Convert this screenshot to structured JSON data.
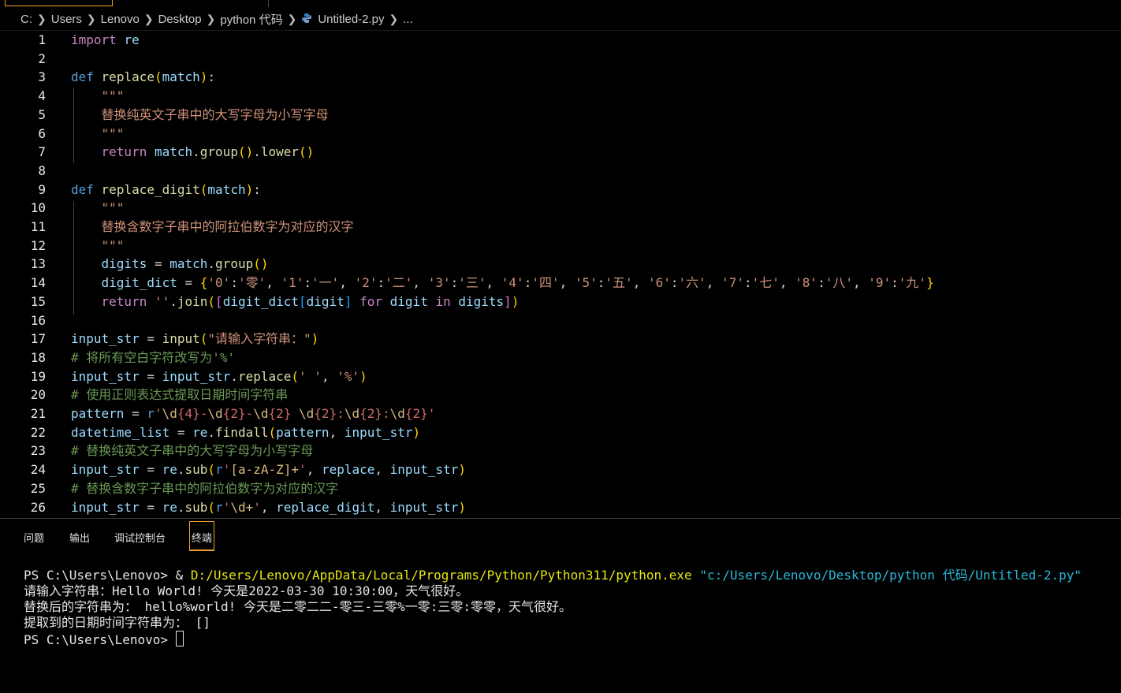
{
  "breadcrumb": {
    "items": [
      "C:",
      "Users",
      "Lenovo",
      "Desktop",
      "python 代码",
      "Untitled-2.py",
      "..."
    ],
    "separator": ">"
  },
  "editor": {
    "lines": [
      {
        "n": "1",
        "tokens": [
          [
            "kwc",
            "import"
          ],
          [
            "op",
            " "
          ],
          [
            "var",
            "re"
          ]
        ]
      },
      {
        "n": "2",
        "tokens": []
      },
      {
        "n": "3",
        "tokens": [
          [
            "kw",
            "def"
          ],
          [
            "op",
            " "
          ],
          [
            "fn",
            "replace"
          ],
          [
            "b1",
            "("
          ],
          [
            "var",
            "match"
          ],
          [
            "b1",
            ")"
          ],
          [
            "op",
            ":"
          ]
        ]
      },
      {
        "n": "4",
        "tokens": [
          [
            "op",
            "    "
          ],
          [
            "str",
            "\"\"\""
          ]
        ]
      },
      {
        "n": "5",
        "tokens": [
          [
            "op",
            "    "
          ],
          [
            "str",
            "替换纯英文子串中的大写字母为小写字母"
          ]
        ]
      },
      {
        "n": "6",
        "tokens": [
          [
            "op",
            "    "
          ],
          [
            "str",
            "\"\"\""
          ]
        ]
      },
      {
        "n": "7",
        "tokens": [
          [
            "op",
            "    "
          ],
          [
            "kwc",
            "return"
          ],
          [
            "op",
            " "
          ],
          [
            "var",
            "match"
          ],
          [
            "op",
            "."
          ],
          [
            "fn",
            "group"
          ],
          [
            "b1",
            "()"
          ],
          [
            "op",
            "."
          ],
          [
            "fn",
            "lower"
          ],
          [
            "b1",
            "()"
          ]
        ]
      },
      {
        "n": "8",
        "tokens": []
      },
      {
        "n": "9",
        "tokens": [
          [
            "kw",
            "def"
          ],
          [
            "op",
            " "
          ],
          [
            "fn",
            "replace_digit"
          ],
          [
            "b1",
            "("
          ],
          [
            "var",
            "match"
          ],
          [
            "b1",
            ")"
          ],
          [
            "op",
            ":"
          ]
        ]
      },
      {
        "n": "10",
        "tokens": [
          [
            "op",
            "    "
          ],
          [
            "str",
            "\"\"\""
          ]
        ]
      },
      {
        "n": "11",
        "tokens": [
          [
            "op",
            "    "
          ],
          [
            "str",
            "替换含数字子串中的阿拉伯数字为对应的汉字"
          ]
        ]
      },
      {
        "n": "12",
        "tokens": [
          [
            "op",
            "    "
          ],
          [
            "str",
            "\"\"\""
          ]
        ]
      },
      {
        "n": "13",
        "tokens": [
          [
            "op",
            "    "
          ],
          [
            "var",
            "digits"
          ],
          [
            "op",
            " = "
          ],
          [
            "var",
            "match"
          ],
          [
            "op",
            "."
          ],
          [
            "fn",
            "group"
          ],
          [
            "b1",
            "()"
          ]
        ]
      },
      {
        "n": "14",
        "tokens": [
          [
            "op",
            "    "
          ],
          [
            "var",
            "digit_dict"
          ],
          [
            "op",
            " = "
          ],
          [
            "b1",
            "{"
          ],
          [
            "str",
            "'0'"
          ],
          [
            "op",
            ":"
          ],
          [
            "str",
            "'零'"
          ],
          [
            "op",
            ", "
          ],
          [
            "str",
            "'1'"
          ],
          [
            "op",
            ":"
          ],
          [
            "str",
            "'一'"
          ],
          [
            "op",
            ", "
          ],
          [
            "str",
            "'2'"
          ],
          [
            "op",
            ":"
          ],
          [
            "str",
            "'二'"
          ],
          [
            "op",
            ", "
          ],
          [
            "str",
            "'3'"
          ],
          [
            "op",
            ":"
          ],
          [
            "str",
            "'三'"
          ],
          [
            "op",
            ", "
          ],
          [
            "str",
            "'4'"
          ],
          [
            "op",
            ":"
          ],
          [
            "str",
            "'四'"
          ],
          [
            "op",
            ", "
          ],
          [
            "str",
            "'5'"
          ],
          [
            "op",
            ":"
          ],
          [
            "str",
            "'五'"
          ],
          [
            "op",
            ", "
          ],
          [
            "str",
            "'6'"
          ],
          [
            "op",
            ":"
          ],
          [
            "str",
            "'六'"
          ],
          [
            "op",
            ", "
          ],
          [
            "str",
            "'7'"
          ],
          [
            "op",
            ":"
          ],
          [
            "str",
            "'七'"
          ],
          [
            "op",
            ", "
          ],
          [
            "str",
            "'8'"
          ],
          [
            "op",
            ":"
          ],
          [
            "str",
            "'八'"
          ],
          [
            "op",
            ", "
          ],
          [
            "str",
            "'9'"
          ],
          [
            "op",
            ":"
          ],
          [
            "str",
            "'九'"
          ],
          [
            "b1",
            "}"
          ]
        ]
      },
      {
        "n": "15",
        "tokens": [
          [
            "op",
            "    "
          ],
          [
            "kwc",
            "return"
          ],
          [
            "op",
            " "
          ],
          [
            "str",
            "''"
          ],
          [
            "op",
            "."
          ],
          [
            "fn",
            "join"
          ],
          [
            "b1",
            "("
          ],
          [
            "b2",
            "["
          ],
          [
            "var",
            "digit_dict"
          ],
          [
            "b3",
            "["
          ],
          [
            "var",
            "digit"
          ],
          [
            "b3",
            "]"
          ],
          [
            "op",
            " "
          ],
          [
            "kwc",
            "for"
          ],
          [
            "op",
            " "
          ],
          [
            "var",
            "digit"
          ],
          [
            "op",
            " "
          ],
          [
            "kwc",
            "in"
          ],
          [
            "op",
            " "
          ],
          [
            "var",
            "digits"
          ],
          [
            "b2",
            "]"
          ],
          [
            "b1",
            ")"
          ]
        ]
      },
      {
        "n": "16",
        "tokens": []
      },
      {
        "n": "17",
        "tokens": [
          [
            "var",
            "input_str"
          ],
          [
            "op",
            " = "
          ],
          [
            "fn",
            "input"
          ],
          [
            "b1",
            "("
          ],
          [
            "str",
            "\"请输入字符串：\""
          ],
          [
            "b1",
            ")"
          ]
        ]
      },
      {
        "n": "18",
        "tokens": [
          [
            "cm",
            "# 将所有空白字符改写为'%'"
          ]
        ]
      },
      {
        "n": "19",
        "tokens": [
          [
            "var",
            "input_str"
          ],
          [
            "op",
            " = "
          ],
          [
            "var",
            "input_str"
          ],
          [
            "op",
            "."
          ],
          [
            "fn",
            "replace"
          ],
          [
            "b1",
            "("
          ],
          [
            "str",
            "' '"
          ],
          [
            "op",
            ", "
          ],
          [
            "str",
            "'%'"
          ],
          [
            "b1",
            ")"
          ]
        ]
      },
      {
        "n": "20",
        "tokens": [
          [
            "cm",
            "# 使用正则表达式提取日期时间字符串"
          ]
        ]
      },
      {
        "n": "21",
        "tokens": [
          [
            "var",
            "pattern"
          ],
          [
            "op",
            " = "
          ],
          [
            "kw",
            "r"
          ],
          [
            "re",
            "'"
          ],
          [
            "rx",
            "\\d"
          ],
          [
            "re",
            "{4}-"
          ],
          [
            "rx",
            "\\d"
          ],
          [
            "re",
            "{2}-"
          ],
          [
            "rx",
            "\\d"
          ],
          [
            "re",
            "{2} "
          ],
          [
            "rx",
            "\\d"
          ],
          [
            "re",
            "{2}:"
          ],
          [
            "rx",
            "\\d"
          ],
          [
            "re",
            "{2}:"
          ],
          [
            "rx",
            "\\d"
          ],
          [
            "re",
            "{2}'"
          ]
        ]
      },
      {
        "n": "22",
        "tokens": [
          [
            "var",
            "datetime_list"
          ],
          [
            "op",
            " = "
          ],
          [
            "var",
            "re"
          ],
          [
            "op",
            "."
          ],
          [
            "fn",
            "findall"
          ],
          [
            "b1",
            "("
          ],
          [
            "var",
            "pattern"
          ],
          [
            "op",
            ", "
          ],
          [
            "var",
            "input_str"
          ],
          [
            "b1",
            ")"
          ]
        ]
      },
      {
        "n": "23",
        "tokens": [
          [
            "cm",
            "# 替换纯英文子串中的大写字母为小写字母"
          ]
        ]
      },
      {
        "n": "24",
        "tokens": [
          [
            "var",
            "input_str"
          ],
          [
            "op",
            " = "
          ],
          [
            "var",
            "re"
          ],
          [
            "op",
            "."
          ],
          [
            "fn",
            "sub"
          ],
          [
            "b1",
            "("
          ],
          [
            "kw",
            "r"
          ],
          [
            "re",
            "'"
          ],
          [
            "rx",
            "[a-zA-Z]+"
          ],
          [
            "re",
            "'"
          ],
          [
            "op",
            ", "
          ],
          [
            "var",
            "replace"
          ],
          [
            "op",
            ", "
          ],
          [
            "var",
            "input_str"
          ],
          [
            "b1",
            ")"
          ]
        ]
      },
      {
        "n": "25",
        "tokens": [
          [
            "cm",
            "# 替换含数字子串中的阿拉伯数字为对应的汉字"
          ]
        ]
      },
      {
        "n": "26",
        "tokens": [
          [
            "var",
            "input_str"
          ],
          [
            "op",
            " = "
          ],
          [
            "var",
            "re"
          ],
          [
            "op",
            "."
          ],
          [
            "fn",
            "sub"
          ],
          [
            "b1",
            "("
          ],
          [
            "kw",
            "r"
          ],
          [
            "re",
            "'"
          ],
          [
            "rx",
            "\\d+"
          ],
          [
            "re",
            "'"
          ],
          [
            "op",
            ", "
          ],
          [
            "var",
            "replace_digit"
          ],
          [
            "op",
            ", "
          ],
          [
            "var",
            "input_str"
          ],
          [
            "b1",
            ")"
          ]
        ]
      }
    ]
  },
  "panel": {
    "tabs": [
      "问题",
      "输出",
      "调试控制台",
      "终端"
    ],
    "active_tab": "终端"
  },
  "terminal": {
    "prompt1": "PS C:\\Users\\Lenovo> ",
    "amp": "& ",
    "exe": "D:/Users/Lenovo/AppData/Local/Programs/Python/Python311/python.exe",
    "script": " \"c:/Users/Lenovo/Desktop/python 代码/Untitled-2.py\"",
    "out1": "请输入字符串：Hello World! 今天是2022-03-30 10:30:00，天气很好。",
    "out2": "替换后的字符串为： hello%world! 今天是二零二二-零三-三零%一零:三零:零零，天气很好。",
    "out3": "提取到的日期时间字符串为： []",
    "prompt2": "PS C:\\Users\\Lenovo> "
  },
  "colors": {
    "background": "#000000",
    "active_tab_border": "#f0a030",
    "keyword": "#569cd6",
    "control_keyword": "#c586c0",
    "function": "#dcdcaa",
    "variable": "#9cdcfe",
    "string": "#ce9178",
    "comment": "#6a9955"
  }
}
